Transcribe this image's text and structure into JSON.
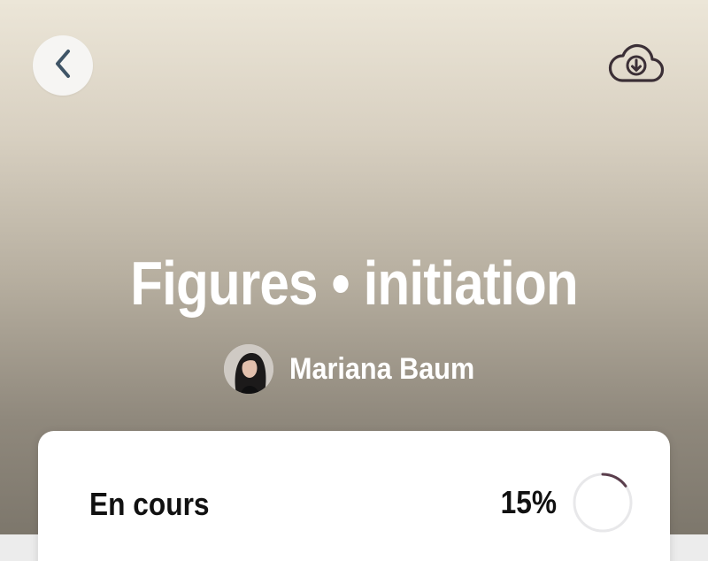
{
  "header": {
    "back_icon": "chevron-left-icon",
    "download_icon": "cloud-download-icon"
  },
  "course": {
    "title": "Figures • initiation",
    "author": "Mariana Baum"
  },
  "progress": {
    "status": "En cours",
    "percent_label": "15%",
    "percent_value": 15
  },
  "colors": {
    "accent_ring": "#5a3e4c",
    "icon_color": "#3b2f36",
    "back_icon_color": "#3f5466"
  }
}
